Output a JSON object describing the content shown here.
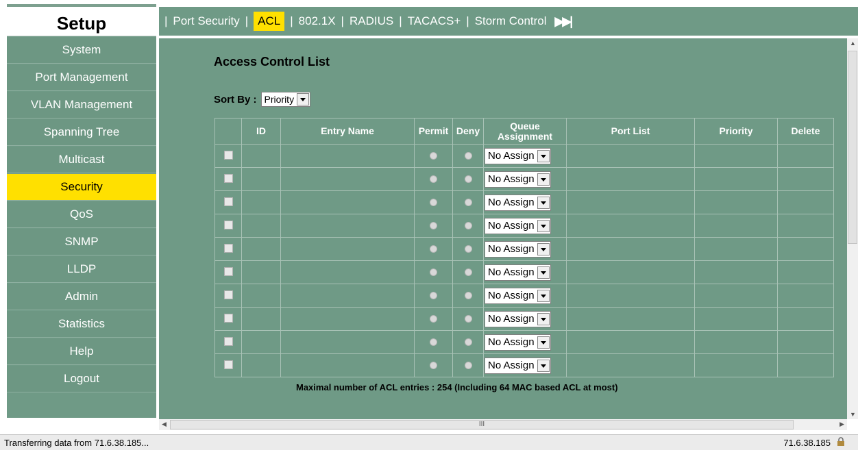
{
  "sidebar": {
    "title": "Setup",
    "items": [
      {
        "label": "System"
      },
      {
        "label": "Port Management"
      },
      {
        "label": "VLAN Management"
      },
      {
        "label": "Spanning Tree"
      },
      {
        "label": "Multicast"
      },
      {
        "label": "Security",
        "active": true
      },
      {
        "label": "QoS"
      },
      {
        "label": "SNMP"
      },
      {
        "label": "LLDP"
      },
      {
        "label": "Admin"
      },
      {
        "label": "Statistics"
      },
      {
        "label": "Help"
      },
      {
        "label": "Logout"
      }
    ]
  },
  "tabs": [
    {
      "label": "Port Security"
    },
    {
      "label": "ACL",
      "active": true
    },
    {
      "label": "802.1X"
    },
    {
      "label": "RADIUS"
    },
    {
      "label": "TACACS+"
    },
    {
      "label": "Storm Control"
    }
  ],
  "main": {
    "title": "Access Control List",
    "sort_label": "Sort By :",
    "sort_value": "Priority",
    "columns": [
      "",
      "ID",
      "Entry Name",
      "Permit",
      "Deny",
      "Queue Assignment",
      "Port List",
      "Priority",
      "Delete"
    ],
    "queue_default": "No Assign",
    "row_count": 10,
    "note": "Maximal number of ACL entries : 254 (Including 64 MAC based ACL at most)"
  },
  "status": {
    "left": "Transferring data from 71.6.38.185...",
    "right": "71.6.38.185"
  },
  "colors": {
    "panel": "#6f9a86",
    "active": "#ffe000"
  }
}
